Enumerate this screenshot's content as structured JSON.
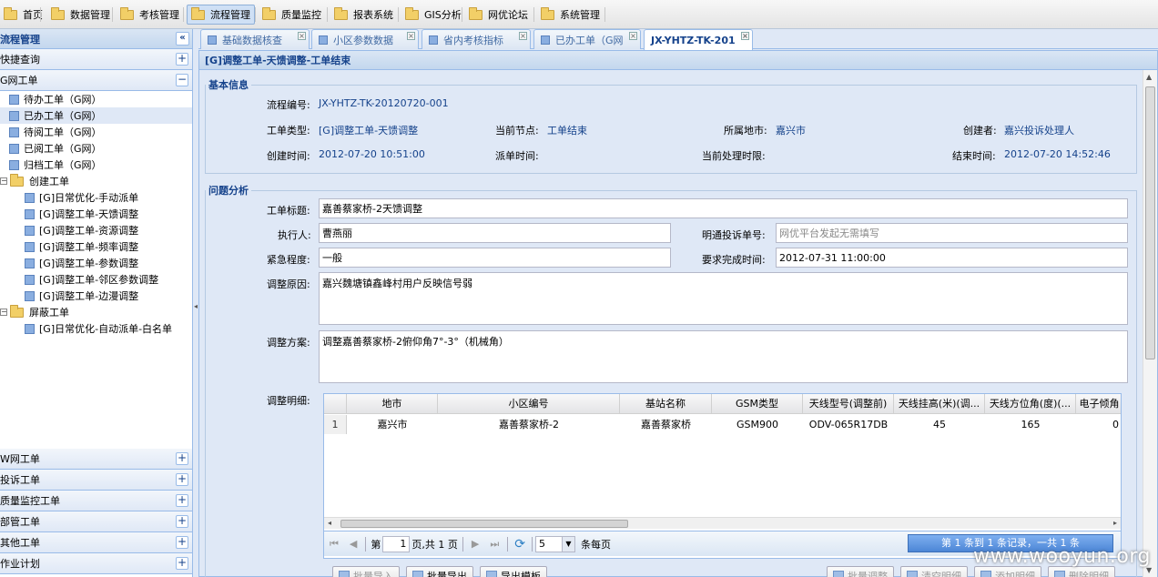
{
  "menu": [
    {
      "label": "首页"
    },
    {
      "label": "数据管理"
    },
    {
      "label": "考核管理"
    },
    {
      "label": "流程管理"
    },
    {
      "label": "质量监控"
    },
    {
      "label": "报表系统"
    },
    {
      "label": "GIS分析"
    },
    {
      "label": "网优论坛"
    },
    {
      "label": "系统管理"
    }
  ],
  "sidebar": {
    "title": "流程管理",
    "quick_search": "快捷查询",
    "g_group": "G网工单",
    "g_items": [
      "待办工单（G网）",
      "已办工单（G网）",
      "待阅工单（G网）",
      "已阅工单（G网）",
      "归档工单（G网）"
    ],
    "create_folder": "创建工单",
    "create_items": [
      "[G]日常优化-手动派单",
      "[G]调整工单-天馈调整",
      "[G]调整工单-资源调整",
      "[G]调整工单-频率调整",
      "[G]调整工单-参数调整",
      "[G]调整工单-邻区参数调整",
      "[G]调整工单-边漫调整"
    ],
    "shield_folder": "屏蔽工单",
    "shield_items": [
      "[G]日常优化-自动派单-白名单"
    ],
    "bottom_groups": [
      "W网工单",
      "投诉工单",
      "质量监控工单",
      "部管工单",
      "其他工单",
      "作业计划"
    ]
  },
  "tabs": [
    {
      "label": "基础数据核查"
    },
    {
      "label": "小区参数数据"
    },
    {
      "label": "省内考核指标"
    },
    {
      "label": "已办工单（G网"
    },
    {
      "label": "JX-YHTZ-TK-201"
    }
  ],
  "panel_title": "[G]调整工单-天馈调整-工单结束",
  "basic": {
    "legend": "基本信息",
    "flow_no_label": "流程编号:",
    "flow_no": "JX-YHTZ-TK-20120720-001",
    "type_label": "工单类型:",
    "type": "[G]调整工单-天馈调整",
    "node_label": "当前节点:",
    "node": "工单结束",
    "city_label": "所属地市:",
    "city": "嘉兴市",
    "creator_label": "创建者:",
    "creator": "嘉兴投诉处理人",
    "created_label": "创建时间:",
    "created": "2012-07-20 10:51:00",
    "dispatch_label": "派单时间:",
    "deadline_label": "当前处理时限:",
    "end_label": "结束时间:",
    "end": "2012-07-20 14:52:46"
  },
  "analysis": {
    "legend": "问题分析",
    "title_label": "工单标题:",
    "title": "嘉善蔡家桥-2天馈调整",
    "executor_label": "执行人:",
    "executor": "曹燕丽",
    "complaint_label": "明通投诉单号:",
    "complaint_placeholder": "网优平台发起无需填写",
    "urgency_label": "紧急程度:",
    "urgency": "一般",
    "due_label": "要求完成时间:",
    "due": "2012-07-31 11:00:00",
    "reason_label": "调整原因:",
    "reason": "嘉兴魏塘镇鑫峰村用户反映信号弱",
    "plan_label": "调整方案:",
    "plan": "调整嘉善蔡家桥-2俯仰角7°-3°（机械角）",
    "detail_label": "调整明细:"
  },
  "grid": {
    "columns": [
      "地市",
      "小区编号",
      "基站名称",
      "GSM类型",
      "天线型号(调整前)",
      "天线挂高(米)(调...",
      "天线方位角(度)(...",
      "电子倾角"
    ],
    "rows": [
      {
        "num": "1",
        "cells": [
          "嘉兴市",
          "嘉善蔡家桥-2",
          "嘉善蔡家桥",
          "GSM900",
          "ODV-065R17DB",
          "45",
          "165",
          "0"
        ]
      }
    ]
  },
  "pager": {
    "page_prefix": "第",
    "page_value": "1",
    "page_suffix": "页,共 1 页",
    "size_value": "5",
    "size_label": "条每页",
    "info": "第 1 条到 1 条记录，一共 1 条"
  },
  "buttons": {
    "batch_import": "批量导入",
    "batch_export": "批量导出",
    "export_template": "导出模板",
    "batch_adjust": "批量调整",
    "clear_detail": "清空明细",
    "add_detail": "添加明细",
    "delete_detail": "删除明细"
  },
  "watermark": "www.wooyun.org"
}
